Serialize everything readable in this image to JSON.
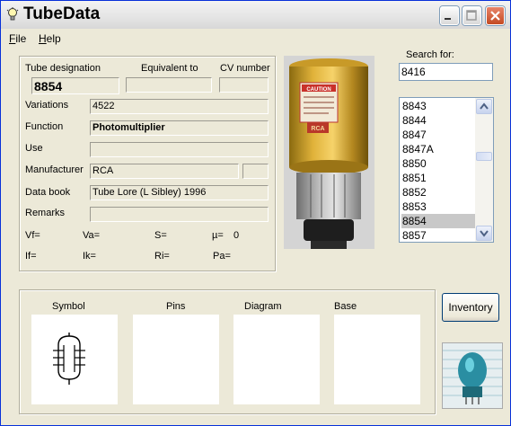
{
  "window": {
    "title": "TubeData"
  },
  "menu": {
    "file": "File",
    "help": "Help"
  },
  "labels": {
    "tube_designation": "Tube designation",
    "equivalent_to": "Equivalent to",
    "cv_number": "CV number",
    "variations": "Variations",
    "function": "Function",
    "use": "Use",
    "manufacturer": "Manufacturer",
    "data_book": "Data book",
    "remarks": "Remarks"
  },
  "values": {
    "tube_designation": "8854",
    "equivalent_to": "",
    "cv_number": "",
    "variations": "4522",
    "function": "Photomultiplier",
    "use": "",
    "manufacturer": "RCA",
    "manufacturer_code": "",
    "data_book": "Tube Lore (L Sibley) 1996",
    "remarks": ""
  },
  "params": {
    "vf": "Vf=",
    "va": "Va=",
    "s": "S=",
    "mu": "µ=",
    "mu_value": "0",
    "if": "If=",
    "ik": "Ik=",
    "ri": "Ri=",
    "pa": "Pa="
  },
  "search": {
    "label": "Search for:",
    "value": "8416"
  },
  "tube_list": [
    "8843",
    "8844",
    "8847",
    "8847A",
    "8850",
    "8851",
    "8852",
    "8853",
    "8854",
    "8857"
  ],
  "tube_list_selected": "8854",
  "photo": {
    "caution_text": "CAUTION",
    "brand_text": "RCA"
  },
  "sections": {
    "symbol": "Symbol",
    "pins": "Pins",
    "diagram": "Diagram",
    "base": "Base"
  },
  "buttons": {
    "inventory": "Inventory"
  },
  "colors": {
    "title_bar": "#e4e4e4",
    "window_bg": "#ece9d8",
    "close_button": "#c44a23",
    "selection": "#c8c8c8"
  }
}
